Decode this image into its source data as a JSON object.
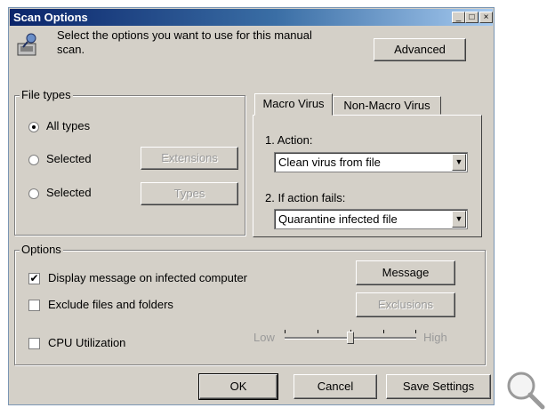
{
  "window": {
    "title": "Scan Options",
    "buttons": {
      "minimize": "_",
      "maximize": "□",
      "close": "×"
    }
  },
  "header": {
    "instruction": "Select the options you want to use for this manual scan.",
    "advanced_label": "Advanced"
  },
  "file_types": {
    "legend": "File types",
    "all_label": "All types",
    "selected1_label": "Selected",
    "selected2_label": "Selected",
    "extensions_label": "Extensions",
    "types_label": "Types",
    "selected_option": "All types"
  },
  "tabs": [
    {
      "label": "Macro Virus",
      "active": true
    },
    {
      "label": "Non-Macro Virus",
      "active": false
    }
  ],
  "macro": {
    "action_label": "1. Action:",
    "action_value": "Clean virus from file",
    "fail_label": "2. If action fails:",
    "fail_value": "Quarantine infected file"
  },
  "options": {
    "legend": "Options",
    "display_msg_label": "Display message on infected computer",
    "display_msg_checked": true,
    "exclude_label": "Exclude files and folders",
    "exclude_checked": false,
    "cpu_label": "CPU Utilization",
    "cpu_checked": false,
    "message_button": "Message",
    "exclusions_button": "Exclusions",
    "slider_low": "Low",
    "slider_high": "High",
    "slider_level": 0.5
  },
  "footer": {
    "ok_label": "OK",
    "cancel_label": "Cancel",
    "save_label": "Save Settings"
  }
}
